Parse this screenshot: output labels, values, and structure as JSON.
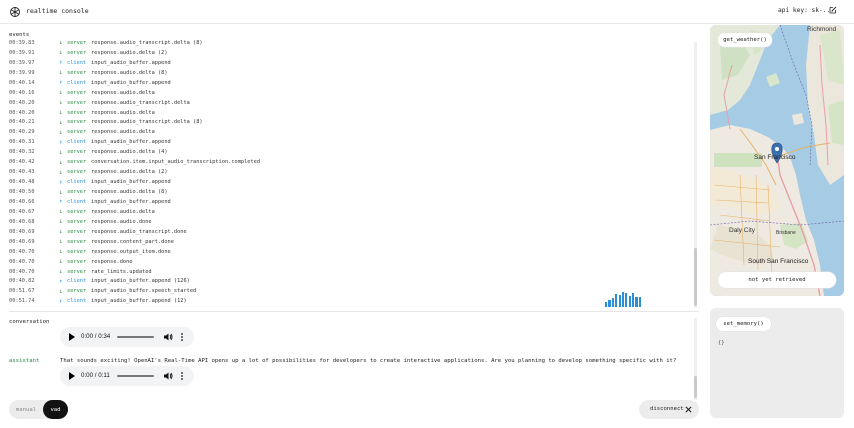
{
  "app": {
    "title": "realtime console",
    "api_key_label": "api key: sk-...",
    "icons": {
      "logo": "openai-logo-icon",
      "edit": "edit-icon"
    }
  },
  "events": {
    "label": "events",
    "items": [
      {
        "time": "00:39.83",
        "direction": "server",
        "arrow": "↓",
        "source": "server",
        "type": "response.audio_transcript.delta (8)"
      },
      {
        "time": "00:39.91",
        "direction": "server",
        "arrow": "↓",
        "source": "server",
        "type": "response.audio.delta (2)"
      },
      {
        "time": "00:39.97",
        "direction": "client",
        "arrow": "↑",
        "source": "client",
        "type": "input_audio_buffer.append"
      },
      {
        "time": "00:39.99",
        "direction": "server",
        "arrow": "↓",
        "source": "server",
        "type": "response.audio.delta (8)"
      },
      {
        "time": "00:40.14",
        "direction": "client",
        "arrow": "↑",
        "source": "client",
        "type": "input_audio_buffer.append"
      },
      {
        "time": "00:40.16",
        "direction": "server",
        "arrow": "↓",
        "source": "server",
        "type": "response.audio.delta"
      },
      {
        "time": "00:40.20",
        "direction": "server",
        "arrow": "↓",
        "source": "server",
        "type": "response.audio_transcript.delta"
      },
      {
        "time": "00:40.20",
        "direction": "server",
        "arrow": "↓",
        "source": "server",
        "type": "response.audio.delta"
      },
      {
        "time": "00:40.21",
        "direction": "server",
        "arrow": "↓",
        "source": "server",
        "type": "response.audio_transcript.delta (8)"
      },
      {
        "time": "00:40.29",
        "direction": "server",
        "arrow": "↓",
        "source": "server",
        "type": "response.audio.delta"
      },
      {
        "time": "00:40.31",
        "direction": "client",
        "arrow": "↑",
        "source": "client",
        "type": "input_audio_buffer.append"
      },
      {
        "time": "00:40.32",
        "direction": "server",
        "arrow": "↓",
        "source": "server",
        "type": "response.audio.delta (4)"
      },
      {
        "time": "00:40.42",
        "direction": "server",
        "arrow": "↓",
        "source": "server",
        "type": "conversation.item.input_audio_transcription.completed"
      },
      {
        "time": "00:40.43",
        "direction": "server",
        "arrow": "↓",
        "source": "server",
        "type": "response.audio.delta (2)"
      },
      {
        "time": "00:40.48",
        "direction": "client",
        "arrow": "↑",
        "source": "client",
        "type": "input_audio_buffer.append"
      },
      {
        "time": "00:40.50",
        "direction": "server",
        "arrow": "↓",
        "source": "server",
        "type": "response.audio.delta (8)"
      },
      {
        "time": "00:40.66",
        "direction": "client",
        "arrow": "↑",
        "source": "client",
        "type": "input_audio_buffer.append"
      },
      {
        "time": "00:40.67",
        "direction": "server",
        "arrow": "↓",
        "source": "server",
        "type": "response.audio.delta"
      },
      {
        "time": "00:40.68",
        "direction": "server",
        "arrow": "↓",
        "source": "server",
        "type": "response.audio.done"
      },
      {
        "time": "00:40.69",
        "direction": "server",
        "arrow": "↓",
        "source": "server",
        "type": "response.audio_transcript.done"
      },
      {
        "time": "00:40.69",
        "direction": "server",
        "arrow": "↓",
        "source": "server",
        "type": "response.content_part.done"
      },
      {
        "time": "00:40.70",
        "direction": "server",
        "arrow": "↓",
        "source": "server",
        "type": "response.output_item.done"
      },
      {
        "time": "00:40.70",
        "direction": "server",
        "arrow": "↓",
        "source": "server",
        "type": "response.done"
      },
      {
        "time": "00:40.70",
        "direction": "server",
        "arrow": "↓",
        "source": "server",
        "type": "rate_limits.updated"
      },
      {
        "time": "00:40.82",
        "direction": "client",
        "arrow": "↑",
        "source": "client",
        "type": "input_audio_buffer.append (126)"
      },
      {
        "time": "00:51.67",
        "direction": "server",
        "arrow": "↓",
        "source": "server",
        "type": "input_audio_buffer.speech_started"
      },
      {
        "time": "00:51.74",
        "direction": "client",
        "arrow": "↑",
        "source": "client",
        "type": "input_audio_buffer.append (12)"
      }
    ],
    "visualization_levels": [
      0.3,
      0.45,
      0.55,
      0.8,
      0.75,
      0.95,
      0.85,
      0.7,
      0.9,
      0.65,
      0.6
    ]
  },
  "conversation": {
    "label": "conversation",
    "items": [
      {
        "role": "",
        "text": "",
        "audio_time": "0:00 / 0:34"
      },
      {
        "role": "assistant",
        "text": "That sounds exciting! OpenAI's Real-Time API opens up a lot of possibilities for developers to create interactive applications. Are you planning to develop something specific with it?",
        "audio_time": "0:00 / 0:11"
      }
    ]
  },
  "controls": {
    "manual_label": "manual",
    "vad_label": "vad",
    "active_mode": "vad",
    "disconnect_label": "disconnect"
  },
  "tools": {
    "weather_button": "get_weather()",
    "weather_status": "not yet retrieved",
    "memory_button": "set_memory()",
    "memory_content": "{}"
  },
  "map": {
    "labels": {
      "richmond": "Richmond",
      "san_francisco": "San Francisco",
      "daly_city": "Daly City",
      "brisbane": "Brisbane",
      "south_sf": "South San Francisco"
    }
  },
  "colors": {
    "server": "#1f8a3a",
    "client": "#2a8fd8",
    "water": "#a6cbe4",
    "land": "#efeae1",
    "marker": "#3a6fb0"
  }
}
